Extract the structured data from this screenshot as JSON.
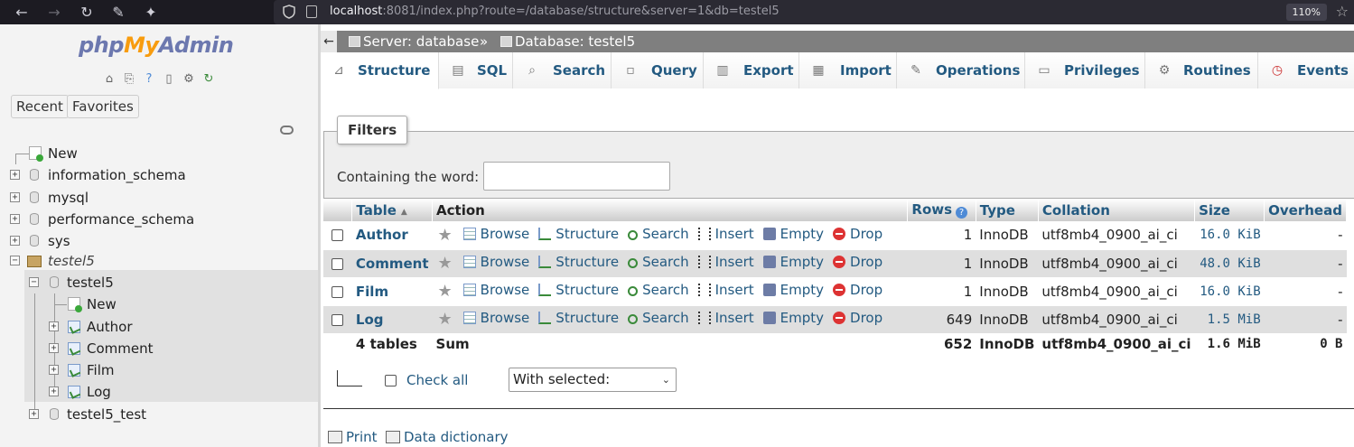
{
  "browser": {
    "url_host": "localhost",
    "url_rest": ":8081/index.php?route=/database/structure&server=1&db=testel5",
    "zoom": "110%"
  },
  "sidebar": {
    "logo": {
      "php": "php",
      "my": "My",
      "admin": "Admin"
    },
    "recent_label": "Recent",
    "favorites_label": "Favorites",
    "tree": {
      "new": "New",
      "databases": [
        "information_schema",
        "mysql",
        "performance_schema",
        "sys"
      ],
      "current_db_group": "testel5",
      "current_db": "testel5",
      "current_db_new": "New",
      "current_tables": [
        "Author",
        "Comment",
        "Film",
        "Log"
      ],
      "other_db": "testel5_test"
    }
  },
  "breadcrumb": {
    "server": "Server: database",
    "separator": "»",
    "database": "Database: testel5"
  },
  "tabs": [
    "Structure",
    "SQL",
    "Search",
    "Query",
    "Export",
    "Import",
    "Operations",
    "Privileges",
    "Routines",
    "Events"
  ],
  "filters": {
    "legend": "Filters",
    "label": "Containing the word:",
    "value": ""
  },
  "table": {
    "headers": {
      "table": "Table",
      "action": "Action",
      "rows": "Rows",
      "type": "Type",
      "collation": "Collation",
      "size": "Size",
      "overhead": "Overhead"
    },
    "actions": {
      "browse": "Browse",
      "structure": "Structure",
      "search": "Search",
      "insert": "Insert",
      "empty": "Empty",
      "drop": "Drop"
    },
    "rows": [
      {
        "name": "Author",
        "rows": "1",
        "type": "InnoDB",
        "collation": "utf8mb4_0900_ai_ci",
        "size": "16.0 KiB",
        "overhead": "-"
      },
      {
        "name": "Comment",
        "rows": "1",
        "type": "InnoDB",
        "collation": "utf8mb4_0900_ai_ci",
        "size": "48.0 KiB",
        "overhead": "-"
      },
      {
        "name": "Film",
        "rows": "1",
        "type": "InnoDB",
        "collation": "utf8mb4_0900_ai_ci",
        "size": "16.0 KiB",
        "overhead": "-"
      },
      {
        "name": "Log",
        "rows": "649",
        "type": "InnoDB",
        "collation": "utf8mb4_0900_ai_ci",
        "size": "1.5 MiB",
        "overhead": "-"
      }
    ],
    "summary": {
      "count": "4 tables",
      "label": "Sum",
      "rows": "652",
      "type": "InnoDB",
      "collation": "utf8mb4_0900_ai_ci",
      "size": "1.6 MiB",
      "overhead": "0 B"
    }
  },
  "bulk": {
    "check_all": "Check all",
    "with_selected": "With selected:"
  },
  "footer_links": {
    "print": "Print",
    "dictionary": "Data dictionary"
  }
}
